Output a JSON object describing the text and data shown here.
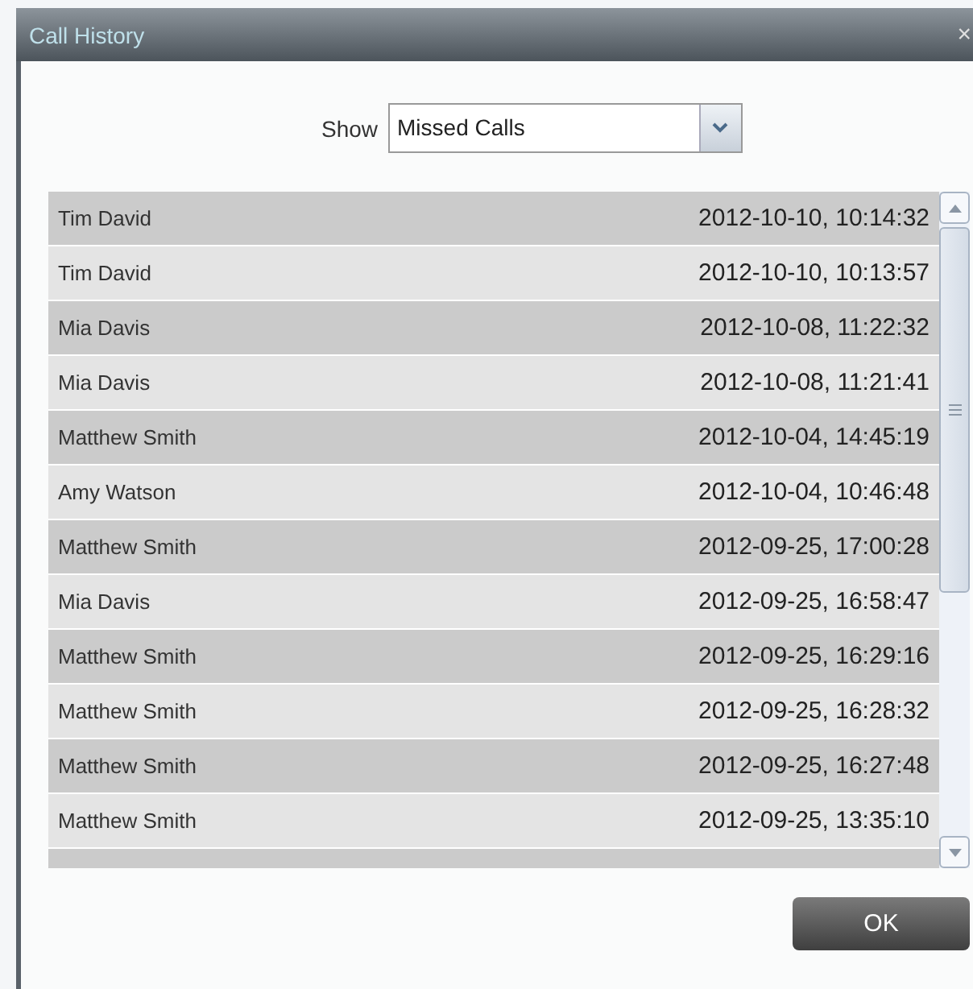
{
  "window": {
    "title": "Call History",
    "close": "×"
  },
  "filter": {
    "label": "Show",
    "value": "Missed Calls"
  },
  "calls": [
    {
      "name": "Tim David",
      "time": "2012-10-10, 10:14:32"
    },
    {
      "name": "Tim David",
      "time": "2012-10-10, 10:13:57"
    },
    {
      "name": "Mia Davis",
      "time": "2012-10-08, 11:22:32"
    },
    {
      "name": "Mia Davis",
      "time": "2012-10-08, 11:21:41"
    },
    {
      "name": "Matthew Smith",
      "time": "2012-10-04, 14:45:19"
    },
    {
      "name": "Amy Watson",
      "time": "2012-10-04, 10:46:48"
    },
    {
      "name": "Matthew Smith",
      "time": "2012-09-25, 17:00:28"
    },
    {
      "name": "Mia Davis",
      "time": "2012-09-25, 16:58:47"
    },
    {
      "name": "Matthew Smith",
      "time": "2012-09-25, 16:29:16"
    },
    {
      "name": "Matthew Smith",
      "time": "2012-09-25, 16:28:32"
    },
    {
      "name": "Matthew Smith",
      "time": "2012-09-25, 16:27:48"
    },
    {
      "name": "Matthew Smith",
      "time": "2012-09-25, 13:35:10"
    }
  ],
  "buttons": [
    "OK"
  ]
}
